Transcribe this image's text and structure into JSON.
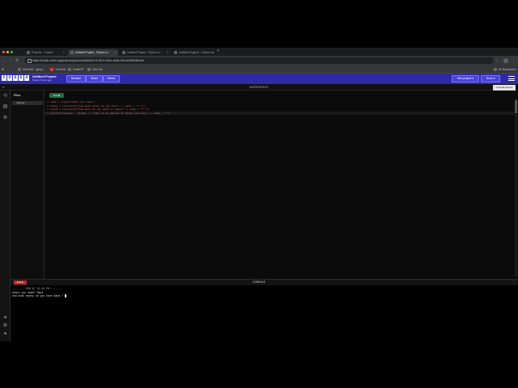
{
  "browser": {
    "tabs": [
      {
        "title": "Projects - CodeAI",
        "active": false
      },
      {
        "title": "Untitled Project - Python Lu",
        "active": true
      },
      {
        "title": "Untitled Project - Python Lu",
        "active": false
      },
      {
        "title": "Untitled Project2 - Python Lu",
        "active": false
      }
    ],
    "new_tab": "+",
    "url": "https://studio.code.org/projects/python/aid3a3b7c4-9674-40ec-ad4e-90c0a0554d6/edit",
    "bookmarks": [
      "Meet AIX - gloss...",
      "YouTube",
      "ChatGPT",
      "Intro Tax"
    ],
    "all_bookmarks": "All Bookmarks"
  },
  "header": {
    "logo": [
      "C",
      "O",
      "D",
      "E",
      "A",
      "I"
    ],
    "project_title": "Untitled Project",
    "project_subtitle": "Saved 3 hours ago",
    "buttons": {
      "rename": "Rename",
      "share": "Share",
      "remix": "Remix",
      "new_project": "New project",
      "more": "Done"
    }
  },
  "workspace": {
    "title": "WORKSPACE",
    "tooltip": "Console and UI",
    "files_title": "Files",
    "file_name": "main.py",
    "run_label": "Run",
    "code_lines": [
      "name = input(\"whats you name\")",
      "money = int(input(\"how much money do you have \" + name + \"? \"))",
      "spend = int(input(\"how much do you want to spend \" + name + \"? \"))",
      "print(str(money - spend) + \" this is te amount of money you have \" + name + \"!\")"
    ]
  },
  "console": {
    "stop_label": "Stop",
    "title": "CONSOLE",
    "lines": [
      "---------RUN AT 10:18 PM---------",
      "whats you name? Kana",
      "how much money do you have Kana ? "
    ]
  }
}
